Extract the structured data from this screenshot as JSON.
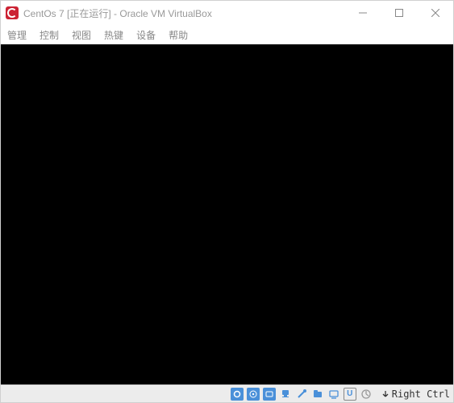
{
  "window": {
    "title": "CentOs 7 [正在运行] - Oracle VM VirtualBox"
  },
  "menu": {
    "items": [
      "管理",
      "控制",
      "视图",
      "热键",
      "设备",
      "帮助"
    ]
  },
  "statusbar": {
    "icons": [
      {
        "name": "hard-disk-icon"
      },
      {
        "name": "optical-drive-icon"
      },
      {
        "name": "audio-icon"
      },
      {
        "name": "network-icon"
      },
      {
        "name": "usb-icon"
      },
      {
        "name": "shared-folders-icon"
      },
      {
        "name": "display-icon"
      },
      {
        "name": "recording-icon"
      },
      {
        "name": "cpu-icon"
      }
    ],
    "hostkey": "Right Ctrl"
  }
}
